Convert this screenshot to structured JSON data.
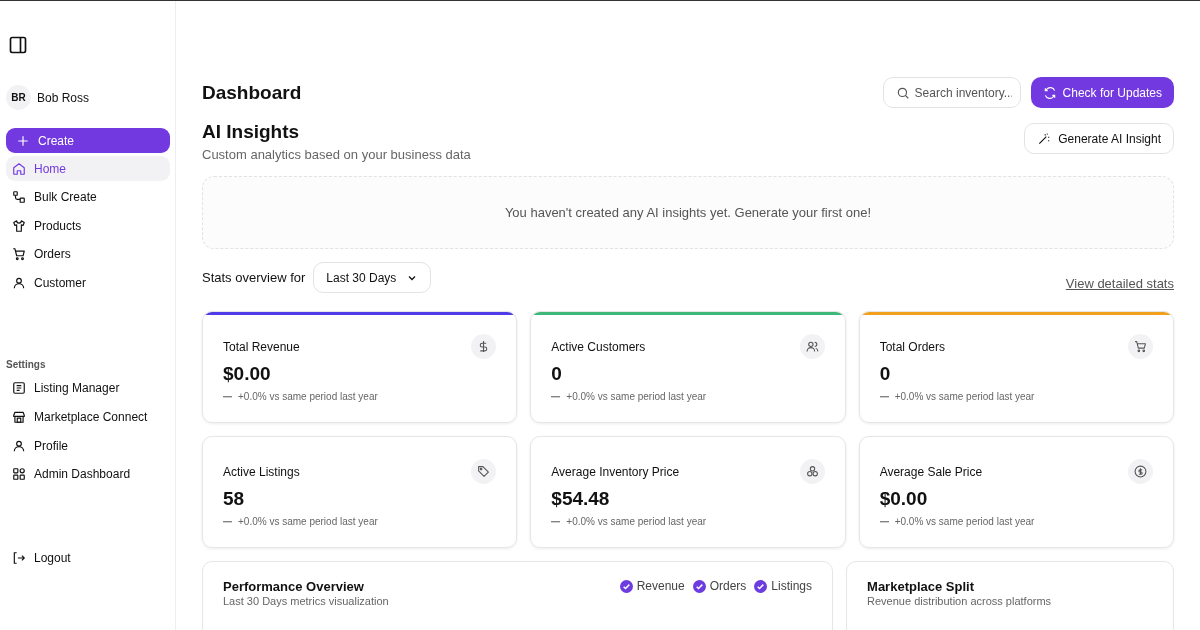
{
  "sidebar": {
    "user": {
      "initials": "BR",
      "name": "Bob Ross"
    },
    "create_button": "Create",
    "nav": [
      {
        "label": "Home",
        "selected": true
      },
      {
        "label": "Bulk Create",
        "selected": false
      },
      {
        "label": "Products",
        "selected": false
      },
      {
        "label": "Orders",
        "selected": false
      },
      {
        "label": "Customer",
        "selected": false
      }
    ],
    "settings_heading": "Settings",
    "settings": [
      {
        "label": "Listing Manager",
        "selected": false
      },
      {
        "label": "Marketplace Connect",
        "selected": false
      },
      {
        "label": "Profile",
        "selected": false
      },
      {
        "label": "Admin Dashboard",
        "selected": false
      }
    ],
    "logout": "Logout"
  },
  "header": {
    "title": "Dashboard",
    "search": {
      "placeholder": "Search inventory..."
    },
    "update_button": "Check for Updates"
  },
  "insights": {
    "title": "AI Insights",
    "subtitle": "Custom analytics based on your business data",
    "generate_button": "Generate AI Insight",
    "empty_message": "You haven't created any AI insights yet. Generate your first one!"
  },
  "stats": {
    "label": "Stats overview for",
    "period": "Last 30 Days",
    "link": "View detailed stats",
    "cards": [
      {
        "title": "Total Revenue",
        "value": "$0.00",
        "change": "+0.0% vs same period last year",
        "color": "#4f3ce8"
      },
      {
        "title": "Active Customers",
        "value": "0",
        "change": "+0.0% vs same period last year",
        "color": "#3fb77a"
      },
      {
        "title": "Total Orders",
        "value": "0",
        "change": "+0.0% vs same period last year",
        "color": "#f0a01c"
      },
      {
        "title": "Active Listings",
        "value": "58",
        "change": "+0.0% vs same period last year"
      },
      {
        "title": "Average Inventory Price",
        "value": "$54.48",
        "change": "+0.0% vs same period last year"
      },
      {
        "title": "Average Sale Price",
        "value": "$0.00",
        "change": "+0.0% vs same period last year"
      }
    ]
  },
  "performance": {
    "title": "Performance Overview",
    "subtitle": "Last 30 Days metrics visualization",
    "legend": [
      {
        "label": "Revenue",
        "checked": true
      },
      {
        "label": "Orders",
        "checked": true
      },
      {
        "label": "Listings",
        "checked": true
      }
    ]
  },
  "marketplace": {
    "title": "Marketplace Split",
    "subtitle": "Revenue distribution across platforms"
  }
}
